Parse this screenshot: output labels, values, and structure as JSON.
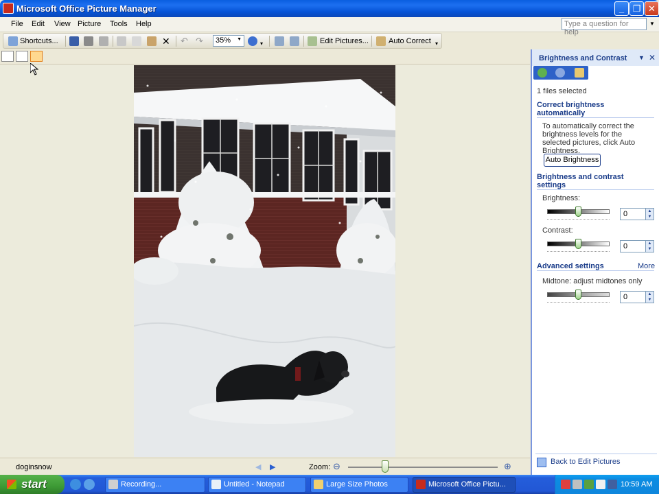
{
  "window": {
    "title": "Microsoft Office Picture Manager"
  },
  "menu": [
    "File",
    "Edit",
    "View",
    "Picture",
    "Tools",
    "Help"
  ],
  "help_placeholder": "Type a question for help",
  "toolbar": {
    "shortcuts_label": "Shortcuts...",
    "zoom_value": "35%",
    "edit_pictures_label": "Edit Pictures...",
    "auto_correct_label": "Auto Correct"
  },
  "statusbar": {
    "filename": "doginsnow",
    "zoom_label": "Zoom:",
    "zoom_slider_fraction": 0.25
  },
  "taskpane": {
    "title": "Brightness and Contrast",
    "files_selected": "1 files selected",
    "section_auto": "Correct brightness automatically",
    "auto_description": "To automatically correct the brightness levels for the selected pictures, click Auto Brightness.",
    "auto_button": "Auto Brightness",
    "section_settings": "Brightness and contrast settings",
    "brightness_label": "Brightness:",
    "brightness_value": "0",
    "contrast_label": "Contrast:",
    "contrast_value": "0",
    "section_advanced": "Advanced settings",
    "more_link": "More",
    "midtone_label": "Midtone: adjust midtones only",
    "midtone_value": "0",
    "back_link": "Back to Edit Pictures"
  },
  "taskbar": {
    "start_label": "start",
    "tasks": [
      {
        "label": "Recording...",
        "active": false
      },
      {
        "label": "Untitled - Notepad",
        "active": false
      },
      {
        "label": "Large Size Photos",
        "active": false
      },
      {
        "label": "Microsoft Office Pictu...",
        "active": true
      }
    ],
    "clock": "10:59 AM"
  },
  "colors": {
    "titlebar": "#0553d6",
    "taskpane_header": "#dfe9f8",
    "accent_text": "#1b3d8a",
    "start_green": "#3d9a35"
  }
}
